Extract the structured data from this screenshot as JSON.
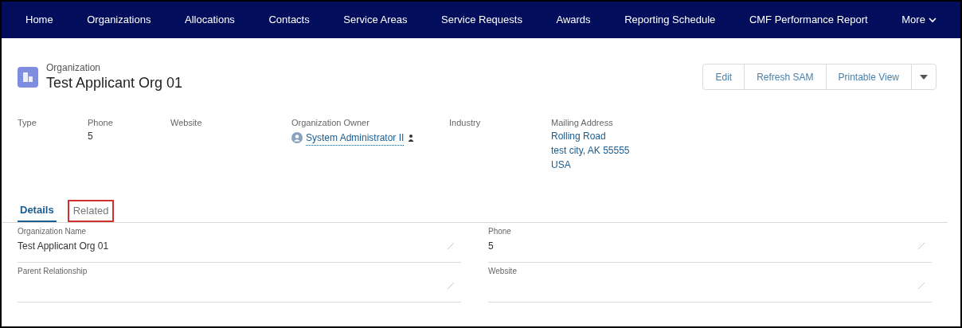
{
  "nav": {
    "items": [
      {
        "label": "Home"
      },
      {
        "label": "Organizations"
      },
      {
        "label": "Allocations"
      },
      {
        "label": "Contacts"
      },
      {
        "label": "Service Areas"
      },
      {
        "label": "Service Requests"
      },
      {
        "label": "Awards"
      },
      {
        "label": "Reporting Schedule"
      },
      {
        "label": "CMF Performance Report"
      }
    ],
    "more": "More"
  },
  "header": {
    "object_type": "Organization",
    "title": "Test Applicant Org 01",
    "actions": [
      "Edit",
      "Refresh SAM",
      "Printable View"
    ]
  },
  "highlights": [
    {
      "label": "Type",
      "kind": "text"
    },
    {
      "label": "Phone",
      "kind": "text",
      "value": "5"
    },
    {
      "label": "Website",
      "kind": "text"
    },
    {
      "label": "Organization Owner",
      "kind": "user",
      "value": "System Administrator II"
    },
    {
      "label": "Industry",
      "kind": "text"
    },
    {
      "label": "Mailing Address",
      "kind": "address",
      "lines": [
        "Rolling Road",
        "test city, AK 55555",
        "USA"
      ]
    }
  ],
  "tabs": [
    {
      "label": "Details",
      "selected": true,
      "highlighted": false
    },
    {
      "label": "Related",
      "selected": false,
      "highlighted": true
    }
  ],
  "fields": [
    {
      "label": "Organization Name",
      "value": "Test Applicant Org 01"
    },
    {
      "label": "Phone",
      "value": "5"
    },
    {
      "label": "Parent Relationship"
    },
    {
      "label": "Website"
    }
  ]
}
